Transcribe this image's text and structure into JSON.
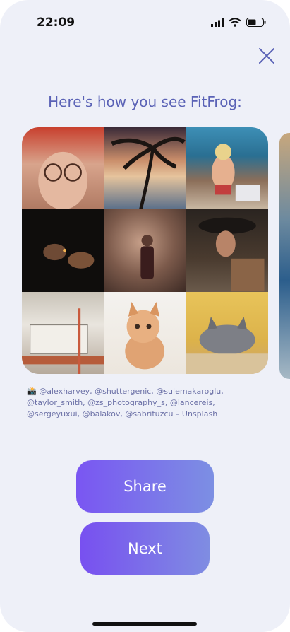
{
  "status_bar": {
    "time": "22:09"
  },
  "title": "Here's how you see FitFrog:",
  "grid": {
    "tiles": [
      {
        "name": "old-woman-photo"
      },
      {
        "name": "palm-beach-photo"
      },
      {
        "name": "woman-rocks-photo"
      },
      {
        "name": "hands-lighter-photo"
      },
      {
        "name": "singer-smoke-photo"
      },
      {
        "name": "woman-hat-photo"
      },
      {
        "name": "boat-photo"
      },
      {
        "name": "kitten-photo"
      },
      {
        "name": "sleeping-cat-photo"
      }
    ]
  },
  "credits": "📸 @alexharvey, @shuttergenic, @sulemakaroglu, @taylor_smith, @zs_photography_s, @lancereis, @sergeyuxui, @balakov, @sabrituzcu – Unsplash",
  "buttons": {
    "share": "Share",
    "next": "Next"
  },
  "icons": {
    "close": "close-icon",
    "signal": "cellular-signal-icon",
    "wifi": "wifi-icon",
    "battery": "battery-icon"
  },
  "colors": {
    "title": "#5a62b6",
    "button_start": "#7a56f2",
    "button_end": "#7c8fe3",
    "background": "#eef0f8"
  }
}
